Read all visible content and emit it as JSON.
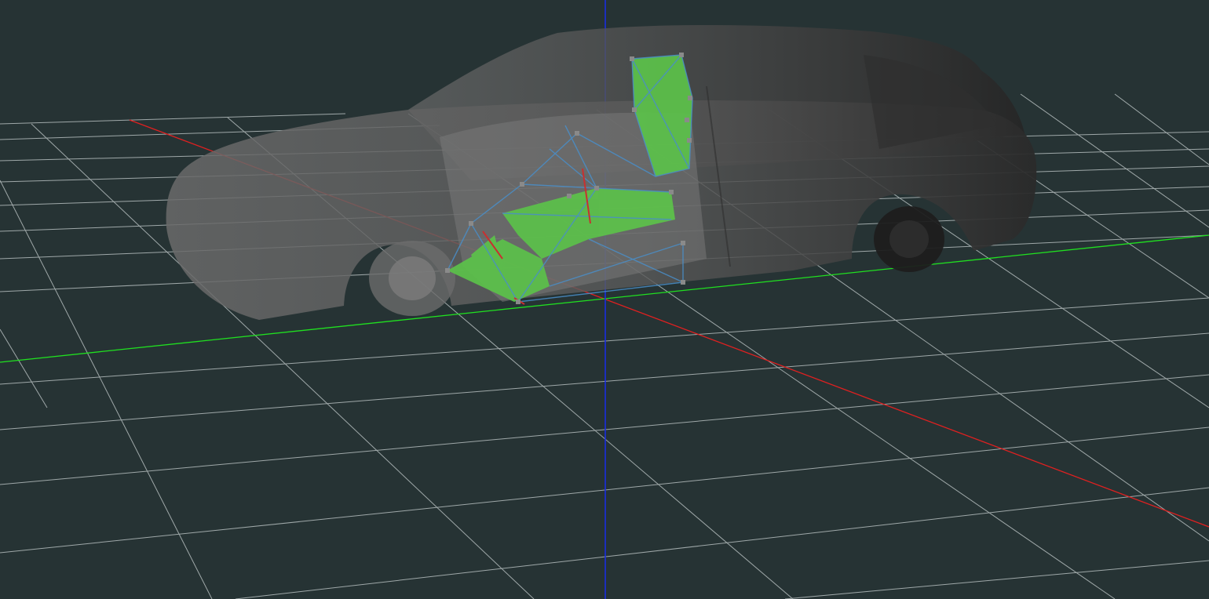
{
  "viewport": {
    "background_color": "#263334",
    "grid_color": "#c8d0d0",
    "axes": {
      "x_color": "#e02020",
      "y_color": "#20e020",
      "z_color": "#1a2ee0"
    },
    "model": {
      "body_color": "#5a5a5a",
      "interior_color": "#6e6e6e",
      "seat_mesh_color": "#5cc24a",
      "wireframe_color": "#4a8ec8",
      "node_color": "#8a8a8a"
    }
  }
}
